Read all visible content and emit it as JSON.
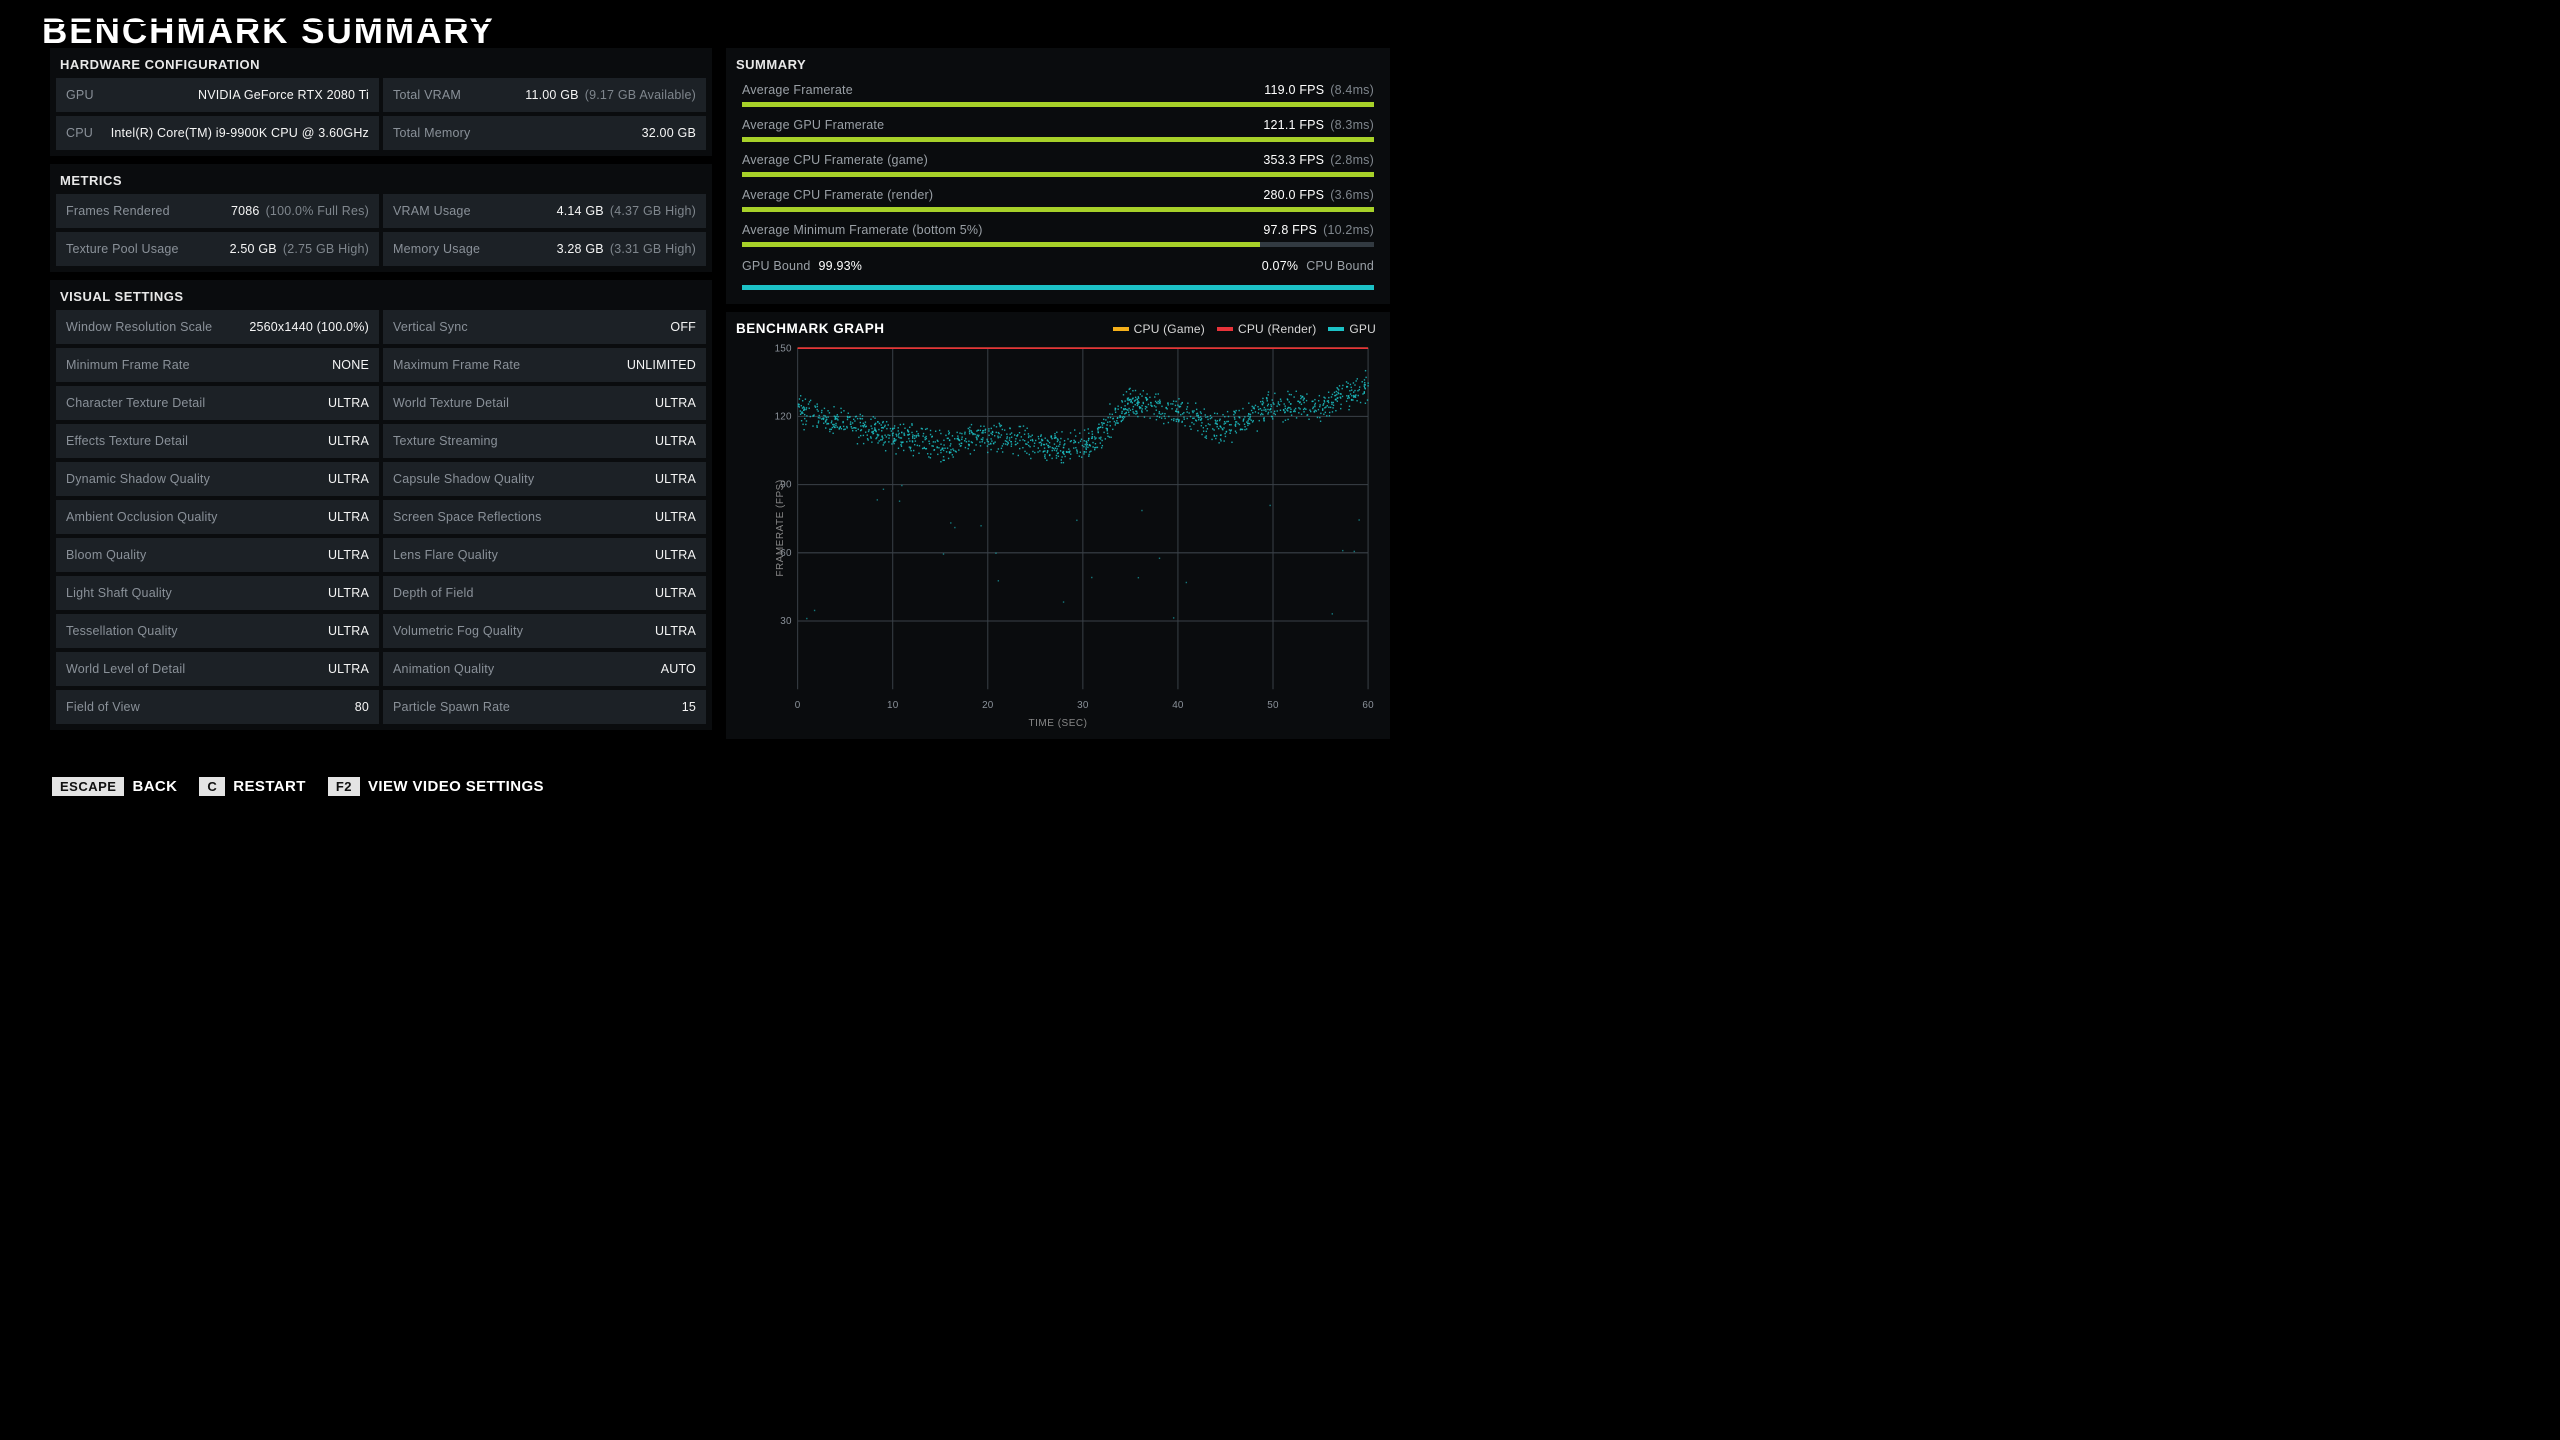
{
  "title": "BENCHMARK SUMMARY",
  "sections": {
    "hardware": "HARDWARE CONFIGURATION",
    "metrics": "METRICS",
    "visual": "VISUAL SETTINGS",
    "summary": "SUMMARY",
    "graph": "BENCHMARK GRAPH"
  },
  "hardware": {
    "gpu": {
      "label": "GPU",
      "value": "NVIDIA GeForce RTX 2080 Ti"
    },
    "vram": {
      "label": "Total VRAM",
      "value": "11.00 GB",
      "sub": "(9.17 GB Available)"
    },
    "cpu": {
      "label": "CPU",
      "value": "Intel(R) Core(TM) i9-9900K CPU @ 3.60GHz"
    },
    "mem": {
      "label": "Total Memory",
      "value": "32.00 GB"
    }
  },
  "metrics": {
    "frames": {
      "label": "Frames Rendered",
      "value": "7086",
      "sub": "(100.0% Full Res)"
    },
    "vramUsage": {
      "label": "VRAM Usage",
      "value": "4.14 GB",
      "sub": "(4.37 GB High)"
    },
    "texPool": {
      "label": "Texture Pool Usage",
      "value": "2.50 GB",
      "sub": "(2.75 GB High)"
    },
    "memUsage": {
      "label": "Memory Usage",
      "value": "3.28 GB",
      "sub": "(3.31 GB High)"
    }
  },
  "visual": [
    {
      "label": "Window Resolution Scale",
      "value": "2560x1440 (100.0%)"
    },
    {
      "label": "Vertical Sync",
      "value": "OFF"
    },
    {
      "label": "Minimum Frame Rate",
      "value": "NONE"
    },
    {
      "label": "Maximum Frame Rate",
      "value": "UNLIMITED"
    },
    {
      "label": "Character Texture Detail",
      "value": "ULTRA"
    },
    {
      "label": "World Texture Detail",
      "value": "ULTRA"
    },
    {
      "label": "Effects Texture Detail",
      "value": "ULTRA"
    },
    {
      "label": "Texture Streaming",
      "value": "ULTRA"
    },
    {
      "label": "Dynamic Shadow Quality",
      "value": "ULTRA"
    },
    {
      "label": "Capsule Shadow Quality",
      "value": "ULTRA"
    },
    {
      "label": "Ambient Occlusion Quality",
      "value": "ULTRA"
    },
    {
      "label": "Screen Space Reflections",
      "value": "ULTRA"
    },
    {
      "label": "Bloom Quality",
      "value": "ULTRA"
    },
    {
      "label": "Lens Flare Quality",
      "value": "ULTRA"
    },
    {
      "label": "Light Shaft Quality",
      "value": "ULTRA"
    },
    {
      "label": "Depth of Field",
      "value": "ULTRA"
    },
    {
      "label": "Tessellation Quality",
      "value": "ULTRA"
    },
    {
      "label": "Volumetric Fog Quality",
      "value": "ULTRA"
    },
    {
      "label": "World Level of Detail",
      "value": "ULTRA"
    },
    {
      "label": "Animation Quality",
      "value": "AUTO"
    },
    {
      "label": "Field of View",
      "value": "80"
    },
    {
      "label": "Particle Spawn Rate",
      "value": "15"
    }
  ],
  "summary": [
    {
      "label": "Average Framerate",
      "value": "119.0 FPS",
      "sub": "(8.4ms)",
      "pct": 100
    },
    {
      "label": "Average GPU Framerate",
      "value": "121.1 FPS",
      "sub": "(8.3ms)",
      "pct": 100
    },
    {
      "label": "Average CPU Framerate (game)",
      "value": "353.3 FPS",
      "sub": "(2.8ms)",
      "pct": 100
    },
    {
      "label": "Average CPU Framerate (render)",
      "value": "280.0 FPS",
      "sub": "(3.6ms)",
      "pct": 100
    },
    {
      "label": "Average Minimum Framerate (bottom 5%)",
      "value": "97.8 FPS",
      "sub": "(10.2ms)",
      "pct": 82
    }
  ],
  "bound": {
    "gpuLabel": "GPU Bound",
    "gpuValue": "99.93%",
    "cpuValue": "0.07%",
    "cpuLabel": "CPU Bound"
  },
  "legend": {
    "cpuGame": "CPU (Game)",
    "cpuRender": "CPU (Render)",
    "gpu": "GPU"
  },
  "axis": {
    "y": "FRAMERATE (FPS)",
    "x": "TIME (SEC)"
  },
  "footer": {
    "escKey": "ESCAPE",
    "escLabel": "BACK",
    "cKey": "C",
    "cLabel": "RESTART",
    "f2Key": "F2",
    "f2Label": "VIEW VIDEO SETTINGS"
  },
  "chart_data": {
    "type": "scatter",
    "xlabel": "TIME (SEC)",
    "ylabel": "FRAMERATE (FPS)",
    "xlim": [
      0,
      60
    ],
    "ylim": [
      0,
      150
    ],
    "xticks": [
      0,
      10,
      20,
      30,
      40,
      50,
      60
    ],
    "yticks": [
      30,
      60,
      90,
      120,
      150
    ],
    "series": [
      {
        "name": "CPU (Game)",
        "color": "#f5b01a",
        "display": "line_at",
        "value": 150,
        "note": "flat line pinned at top (~150)"
      },
      {
        "name": "CPU (Render)",
        "color": "#e8333a",
        "display": "line_at",
        "value": 150,
        "note": "flat line pinned at top (~150)"
      },
      {
        "name": "GPU",
        "color": "#1cc2c6",
        "display": "scatter_band",
        "x": [
          0,
          5,
          10,
          15,
          20,
          25,
          30,
          35,
          40,
          45,
          50,
          55,
          60
        ],
        "center": [
          123,
          117,
          112,
          107,
          112,
          109,
          106,
          127,
          122,
          115,
          125,
          125,
          135
        ],
        "spread": 6,
        "note": "dense scatter; center ± spread approximates the cloud"
      }
    ]
  }
}
